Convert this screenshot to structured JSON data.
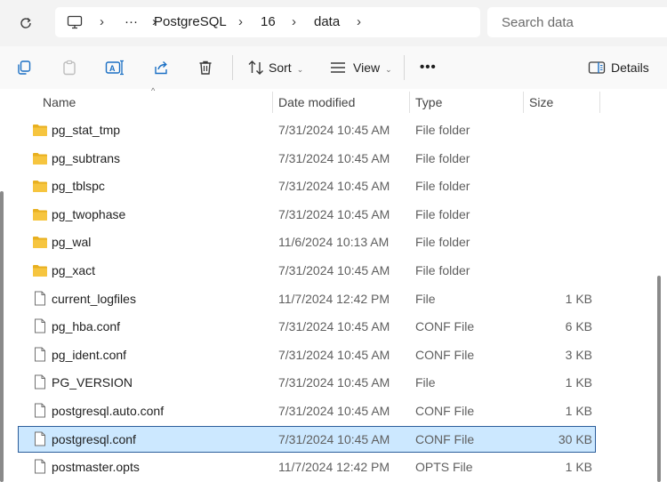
{
  "address": {
    "ellipsis": "···",
    "crumbs": [
      "PostgreSQL",
      "16",
      "data"
    ]
  },
  "search": {
    "placeholder": "Search data"
  },
  "toolbar": {
    "sort_label": "Sort",
    "view_label": "View",
    "more_label": "•••",
    "details_label": "Details"
  },
  "columns": {
    "name": "Name",
    "date": "Date modified",
    "type": "Type",
    "size": "Size"
  },
  "rows": [
    {
      "name": "pg_stat_tmp",
      "date": "7/31/2024 10:45 AM",
      "type": "File folder",
      "size": "",
      "icon": "folder-icon"
    },
    {
      "name": "pg_subtrans",
      "date": "7/31/2024 10:45 AM",
      "type": "File folder",
      "size": "",
      "icon": "folder-icon"
    },
    {
      "name": "pg_tblspc",
      "date": "7/31/2024 10:45 AM",
      "type": "File folder",
      "size": "",
      "icon": "folder-icon"
    },
    {
      "name": "pg_twophase",
      "date": "7/31/2024 10:45 AM",
      "type": "File folder",
      "size": "",
      "icon": "folder-icon"
    },
    {
      "name": "pg_wal",
      "date": "11/6/2024 10:13 AM",
      "type": "File folder",
      "size": "",
      "icon": "folder-icon"
    },
    {
      "name": "pg_xact",
      "date": "7/31/2024 10:45 AM",
      "type": "File folder",
      "size": "",
      "icon": "folder-icon"
    },
    {
      "name": "current_logfiles",
      "date": "11/7/2024 12:42 PM",
      "type": "File",
      "size": "1 KB",
      "icon": "file-icon"
    },
    {
      "name": "pg_hba.conf",
      "date": "7/31/2024 10:45 AM",
      "type": "CONF File",
      "size": "6 KB",
      "icon": "file-icon"
    },
    {
      "name": "pg_ident.conf",
      "date": "7/31/2024 10:45 AM",
      "type": "CONF File",
      "size": "3 KB",
      "icon": "file-icon"
    },
    {
      "name": "PG_VERSION",
      "date": "7/31/2024 10:45 AM",
      "type": "File",
      "size": "1 KB",
      "icon": "file-icon"
    },
    {
      "name": "postgresql.auto.conf",
      "date": "7/31/2024 10:45 AM",
      "type": "CONF File",
      "size": "1 KB",
      "icon": "file-icon"
    },
    {
      "name": "postgresql.conf",
      "date": "7/31/2024 10:45 AM",
      "type": "CONF File",
      "size": "30 KB",
      "icon": "file-icon",
      "selected": true
    },
    {
      "name": "postmaster.opts",
      "date": "11/7/2024 12:42 PM",
      "type": "OPTS File",
      "size": "1 KB",
      "icon": "file-icon"
    }
  ],
  "colors": {
    "folder": "#f4c430",
    "selection": "#cce8ff",
    "selection_border": "#2b5d9a",
    "accent": "#0067c0"
  }
}
